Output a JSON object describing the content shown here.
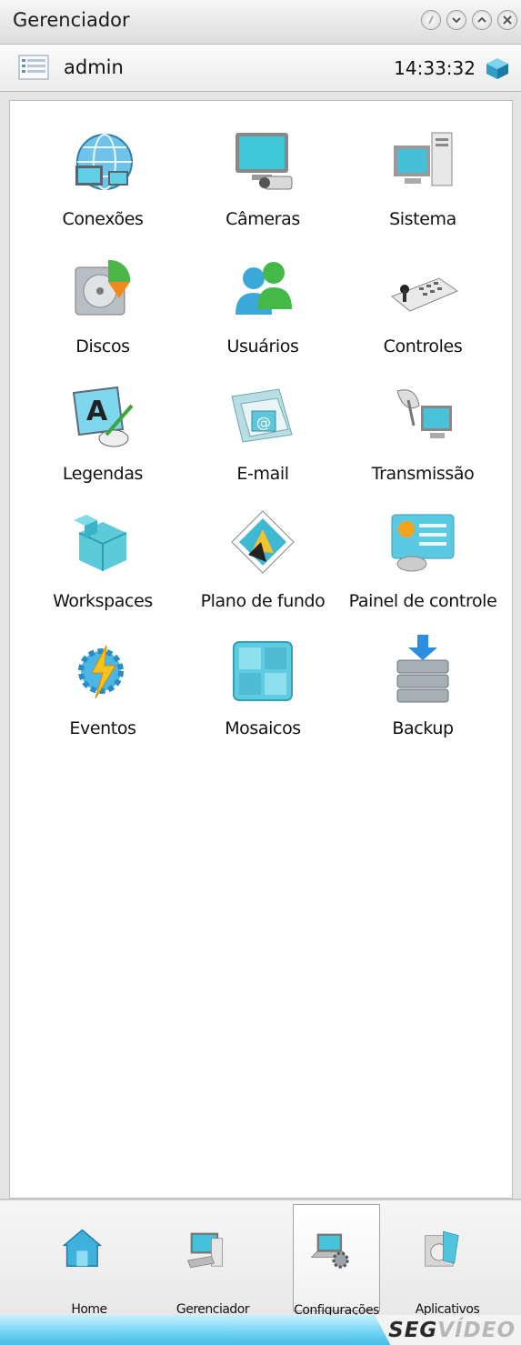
{
  "window": {
    "title": "Gerenciador"
  },
  "userbar": {
    "user": "admin",
    "time": "14:33:32"
  },
  "menu": [
    {
      "label": "Conexões",
      "icon": "globe-network-icon"
    },
    {
      "label": "Câmeras",
      "icon": "camera-monitor-icon"
    },
    {
      "label": "Sistema",
      "icon": "computer-system-icon"
    },
    {
      "label": "Discos",
      "icon": "disk-drive-icon"
    },
    {
      "label": "Usuários",
      "icon": "users-icon"
    },
    {
      "label": "Controles",
      "icon": "keyboard-controller-icon"
    },
    {
      "label": "Legendas",
      "icon": "caption-text-icon"
    },
    {
      "label": "E-mail",
      "icon": "email-icon"
    },
    {
      "label": "Transmissão",
      "icon": "satellite-transmission-icon"
    },
    {
      "label": "Workspaces",
      "icon": "workspace-cubes-icon"
    },
    {
      "label": "Plano de fundo",
      "icon": "wallpaper-icon"
    },
    {
      "label": "Painel de controle",
      "icon": "control-panel-icon"
    },
    {
      "label": "Eventos",
      "icon": "events-gear-lightning-icon"
    },
    {
      "label": "Mosaicos",
      "icon": "mosaic-icon"
    },
    {
      "label": "Backup",
      "icon": "backup-database-icon"
    }
  ],
  "bottom_nav": [
    {
      "label": "Home",
      "icon": "home-icon",
      "active": false
    },
    {
      "label": "Gerenciador",
      "icon": "manager-computer-icon",
      "active": false
    },
    {
      "label": "Configurações",
      "icon": "settings-laptop-icon",
      "active": true
    },
    {
      "label": "Aplicativos",
      "icon": "applications-icon",
      "active": false
    }
  ],
  "footer": {
    "brand_a": "SEG",
    "brand_b": "VÍDEO"
  },
  "colors": {
    "accent": "#3fb7e3",
    "window_bg": "#e4e4e4"
  }
}
